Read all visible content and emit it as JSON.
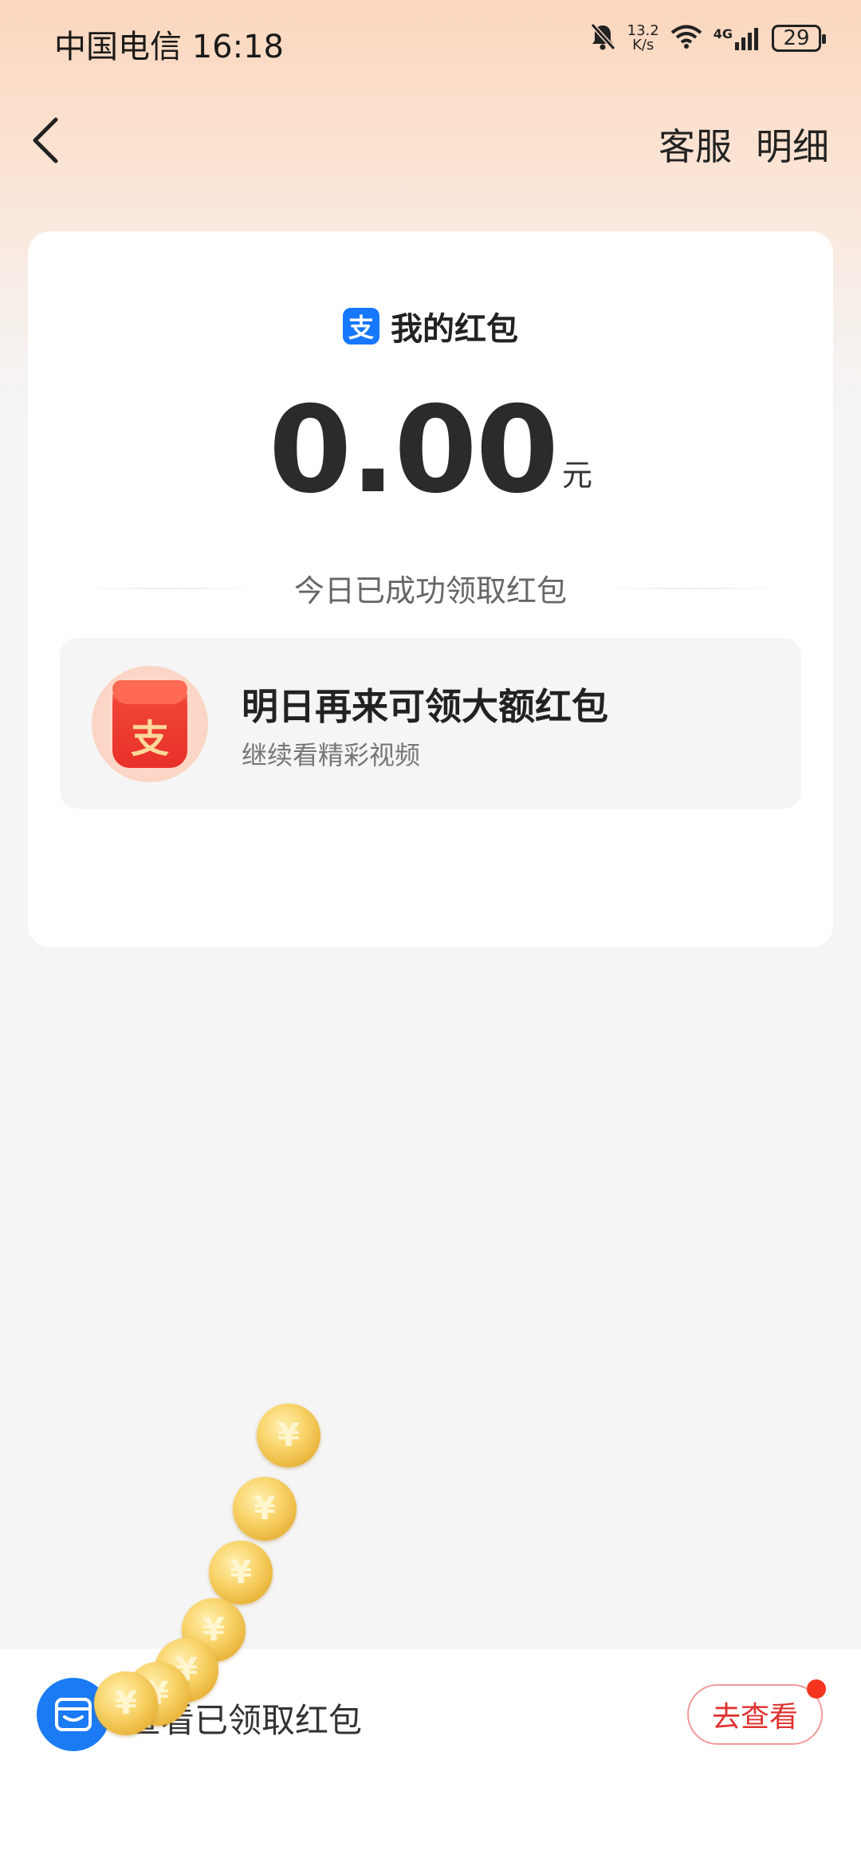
{
  "status_bar": {
    "carrier_time": "中国电信 16:18",
    "net_speed_value": "13.2",
    "net_speed_unit": "K/s",
    "network_type": "4G",
    "battery": "29"
  },
  "nav": {
    "customer_service": "客服",
    "details": "明细"
  },
  "card": {
    "title": "我的红包",
    "alipay_badge": "支",
    "amount": "0.00",
    "unit": "元",
    "status_text": "今日已成功领取红包",
    "promo": {
      "envelope_char": "支",
      "title": "明日再来可领大额红包",
      "subtitle": "继续看精彩视频"
    }
  },
  "bottom_bar": {
    "text": "查看已领取红包",
    "button": "去查看"
  },
  "coin_symbol": "¥",
  "colors": {
    "alipay_blue": "#1677ff",
    "accent_red": "#e0312f",
    "notification_dot": "#f5341f"
  }
}
